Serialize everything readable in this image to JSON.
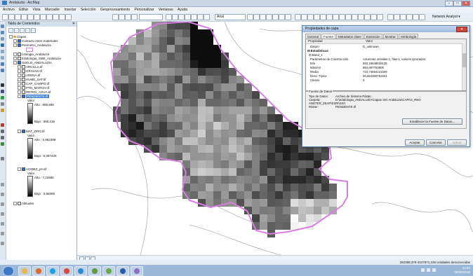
{
  "window": {
    "title": "Andaluzia - ArcMap",
    "min": "–",
    "max": "□",
    "close": "✕"
  },
  "menu": [
    "Archivo",
    "Editar",
    "Vista",
    "Marcador",
    "Insertar",
    "Selección",
    "Geoprocesamiento",
    "Personalizar",
    "Ventanas",
    "Ayuda"
  ],
  "toolbar": {
    "scale": "",
    "font": "Arial",
    "network_analyst": "Network Analyst ▾"
  },
  "toc": {
    "title": "Tabla de Contenidos",
    "close": "✕",
    "items": [
      {
        "label": "Capas"
      },
      {
        "label": "Contacto entre materiales"
      },
      {
        "label": "Perimetro_Andaluzia"
      },
      {
        "label": "Litologia_Andaluzia"
      },
      {
        "label": "Edafologia_SME_Andaluzia"
      },
      {
        "label": "SUELO_ANDALUZIA"
      },
      {
        "label": "ARCILLA.tif"
      },
      {
        "label": "GRAVAS.tif"
      },
      {
        "label": "ARENA.tif"
      },
      {
        "label": "HUME_SAT.tif"
      },
      {
        "label": "CAP_CAMPO.tif"
      },
      {
        "label": "PTO_MARCH.tif"
      },
      {
        "label": "RETEN_AGUA.tif"
      },
      {
        "label": "PENDIENTE.tif"
      },
      {
        "label": "Valor"
      },
      {
        "label": "Alto : 886,698"
      },
      {
        "label": "Bajo : 590,135"
      },
      {
        "label": "MAT_ORG.tif"
      },
      {
        "label": "Valor"
      },
      {
        "label": "Alto : 5,962398"
      },
      {
        "label": "Bajo : 0,087425"
      },
      {
        "label": "ACIDEZ_pH.tif"
      },
      {
        "label": "Valor"
      },
      {
        "label": "Alto : 7,22586"
      },
      {
        "label": "Bajo : 0,86085"
      },
      {
        "label": "Altitudes"
      }
    ]
  },
  "dialog": {
    "title": "Propiedades de capa",
    "close": "✕",
    "tabs": [
      "General",
      "Fuente",
      "Metadatos clave",
      "Extensión",
      "Mostrar",
      "Simbología"
    ],
    "active_tab": "Fuente",
    "props_header": {
      "name": "Propiedad",
      "value": "Valor"
    },
    "props": [
      {
        "name": "Datum",
        "value": "D_unknown"
      },
      {
        "name": "⊟ Estadísticas",
        "value": ""
      },
      {
        "name": "⊟ Band_1",
        "value": ""
      },
      {
        "name": "Parámetros de Construcción",
        "value": "columnas omitidas:1, filas:1, valores ignorados:"
      },
      {
        "name": "Mín",
        "value": "593,15548828125"
      },
      {
        "name": "Máximo",
        "value": "884,697753906"
      },
      {
        "name": "Media",
        "value": "744,74594421509"
      },
      {
        "name": "Desv. Típica",
        "value": "56,664360751941"
      },
      {
        "name": "Clases",
        "value": "0"
      }
    ],
    "source_group": "Fuente de Datos",
    "source": [
      {
        "k": "Tipo de Datos:",
        "v": "Archivo de Sistema Ráster"
      },
      {
        "k": "Carpeta:",
        "v": "D:\\Edafologia_ANDALUZIA\\Capas SIG Andaluzia\\CAPAS_RNO"
      },
      {
        "k": "",
        "v": "ANDTER_ZEAP\\ESRI\\SIG\\"
      },
      {
        "k": "Ráster:",
        "v": "PENDIENTE.tif"
      }
    ],
    "set_source_btn": "Establecer la Fuente de Datos...",
    "ok": "Aceptar",
    "cancel": "Cancelar",
    "apply": "Aplicar"
  },
  "status": {
    "coords": "282388,379  4347871,245 Unidades desconocidas"
  },
  "clock": {
    "time": "12:44",
    "date": "08/06/2016"
  },
  "map": {
    "raster_fill": "#777777",
    "boundary_color": "#d67fe0",
    "contour_color": "#9a9a9a"
  }
}
